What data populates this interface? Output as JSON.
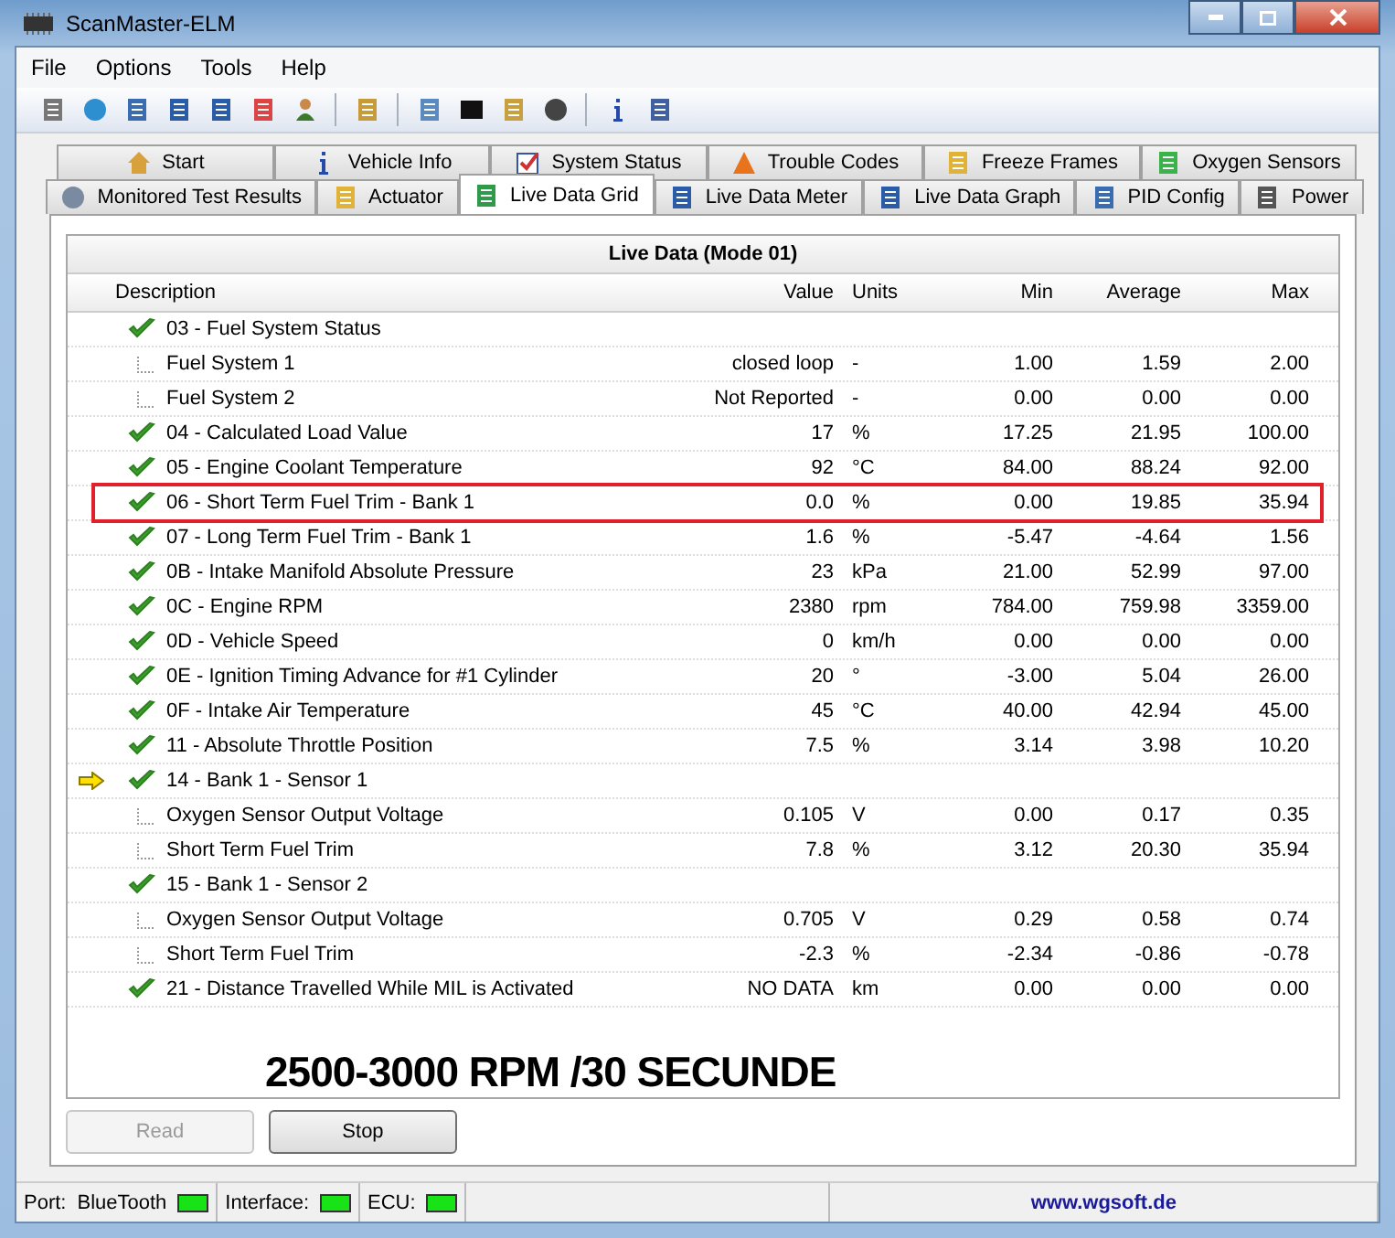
{
  "window": {
    "title": "ScanMaster-ELM"
  },
  "menu": [
    "File",
    "Options",
    "Tools",
    "Help"
  ],
  "tabs_back": [
    {
      "label": "Start",
      "selected": false
    },
    {
      "label": "Vehicle Info",
      "selected": false
    },
    {
      "label": "System Status",
      "selected": false
    },
    {
      "label": "Trouble Codes",
      "selected": false
    },
    {
      "label": "Freeze Frames",
      "selected": false
    },
    {
      "label": "Oxygen Sensors",
      "selected": false
    }
  ],
  "tabs_front": [
    {
      "label": "Monitored Test Results",
      "selected": false
    },
    {
      "label": "Actuator",
      "selected": false
    },
    {
      "label": "Live Data Grid",
      "selected": true
    },
    {
      "label": "Live Data Meter",
      "selected": false
    },
    {
      "label": "Live Data Graph",
      "selected": false
    },
    {
      "label": "PID Config",
      "selected": false
    },
    {
      "label": "Power",
      "selected": false
    }
  ],
  "grid": {
    "title": "Live Data (Mode 01)",
    "columns": [
      "Description",
      "Value",
      "Units",
      "Min",
      "Average",
      "Max"
    ],
    "rows": [
      {
        "kind": "pid",
        "description": "03 - Fuel System Status",
        "current": false,
        "highlighted": false
      },
      {
        "kind": "sub",
        "description": "Fuel System 1",
        "value": "closed loop",
        "units": "-",
        "min": "1.00",
        "average": "1.59",
        "max": "2.00",
        "highlighted": false
      },
      {
        "kind": "sub",
        "description": "Fuel System 2",
        "value": "Not Reported",
        "units": "-",
        "min": "0.00",
        "average": "0.00",
        "max": "0.00",
        "highlighted": false
      },
      {
        "kind": "pid",
        "description": "04 - Calculated Load Value",
        "value": "17",
        "units": "%",
        "min": "17.25",
        "average": "21.95",
        "max": "100.00",
        "current": false,
        "highlighted": false
      },
      {
        "kind": "pid",
        "description": "05 - Engine Coolant Temperature",
        "value": "92",
        "units": "°C",
        "min": "84.00",
        "average": "88.24",
        "max": "92.00",
        "current": false,
        "highlighted": false
      },
      {
        "kind": "pid",
        "description": "06 - Short Term Fuel Trim - Bank 1",
        "value": "0.0",
        "units": "%",
        "min": "0.00",
        "average": "19.85",
        "max": "35.94",
        "current": false,
        "highlighted": true
      },
      {
        "kind": "pid",
        "description": "07 - Long Term Fuel Trim - Bank 1",
        "value": "1.6",
        "units": "%",
        "min": "-5.47",
        "average": "-4.64",
        "max": "1.56",
        "current": false,
        "highlighted": false
      },
      {
        "kind": "pid",
        "description": "0B - Intake Manifold Absolute Pressure",
        "value": "23",
        "units": "kPa",
        "min": "21.00",
        "average": "52.99",
        "max": "97.00",
        "current": false,
        "highlighted": false
      },
      {
        "kind": "pid",
        "description": "0C - Engine RPM",
        "value": "2380",
        "units": "rpm",
        "min": "784.00",
        "average": "759.98",
        "max": "3359.00",
        "current": false,
        "highlighted": false
      },
      {
        "kind": "pid",
        "description": "0D - Vehicle Speed",
        "value": "0",
        "units": "km/h",
        "min": "0.00",
        "average": "0.00",
        "max": "0.00",
        "current": false,
        "highlighted": false
      },
      {
        "kind": "pid",
        "description": "0E - Ignition Timing Advance for #1 Cylinder",
        "value": "20",
        "units": "°",
        "min": "-3.00",
        "average": "5.04",
        "max": "26.00",
        "current": false,
        "highlighted": false
      },
      {
        "kind": "pid",
        "description": "0F - Intake Air Temperature",
        "value": "45",
        "units": "°C",
        "min": "40.00",
        "average": "42.94",
        "max": "45.00",
        "current": false,
        "highlighted": false
      },
      {
        "kind": "pid",
        "description": "11 - Absolute Throttle Position",
        "value": "7.5",
        "units": "%",
        "min": "3.14",
        "average": "3.98",
        "max": "10.20",
        "current": false,
        "highlighted": false
      },
      {
        "kind": "pid",
        "description": "14 - Bank 1 - Sensor 1",
        "current": true,
        "highlighted": false
      },
      {
        "kind": "sub",
        "description": "Oxygen Sensor Output Voltage",
        "value": "0.105",
        "units": "V",
        "min": "0.00",
        "average": "0.17",
        "max": "0.35",
        "highlighted": false
      },
      {
        "kind": "sub",
        "description": "Short Term Fuel Trim",
        "value": "7.8",
        "units": "%",
        "min": "3.12",
        "average": "20.30",
        "max": "35.94",
        "highlighted": false
      },
      {
        "kind": "pid",
        "description": "15 - Bank 1 - Sensor 2",
        "current": false,
        "highlighted": false
      },
      {
        "kind": "sub",
        "description": "Oxygen Sensor Output Voltage",
        "value": "0.705",
        "units": "V",
        "min": "0.29",
        "average": "0.58",
        "max": "0.74",
        "highlighted": false
      },
      {
        "kind": "sub",
        "description": "Short Term Fuel Trim",
        "value": "-2.3",
        "units": "%",
        "min": "-2.34",
        "average": "-0.86",
        "max": "-0.78",
        "highlighted": false
      },
      {
        "kind": "pid",
        "description": "21 - Distance Travelled While MIL is Activated",
        "value": "NO DATA",
        "units": "km",
        "min": "0.00",
        "average": "0.00",
        "max": "0.00",
        "current": false,
        "highlighted": false
      }
    ],
    "annotation": "2500-3000 RPM /30 SECUNDE"
  },
  "buttons": [
    {
      "label": "Read",
      "disabled": true
    },
    {
      "label": "Stop",
      "disabled": false
    }
  ],
  "status_bar": {
    "port_label": "Port:",
    "port_value": "BlueTooth",
    "port_led": {
      "on": true
    },
    "interface_label": "Interface:",
    "interface_led": {
      "on": true
    },
    "ecu_label": "ECU:",
    "ecu_led": {
      "on": true
    },
    "link": "www.wgsoft.de"
  }
}
